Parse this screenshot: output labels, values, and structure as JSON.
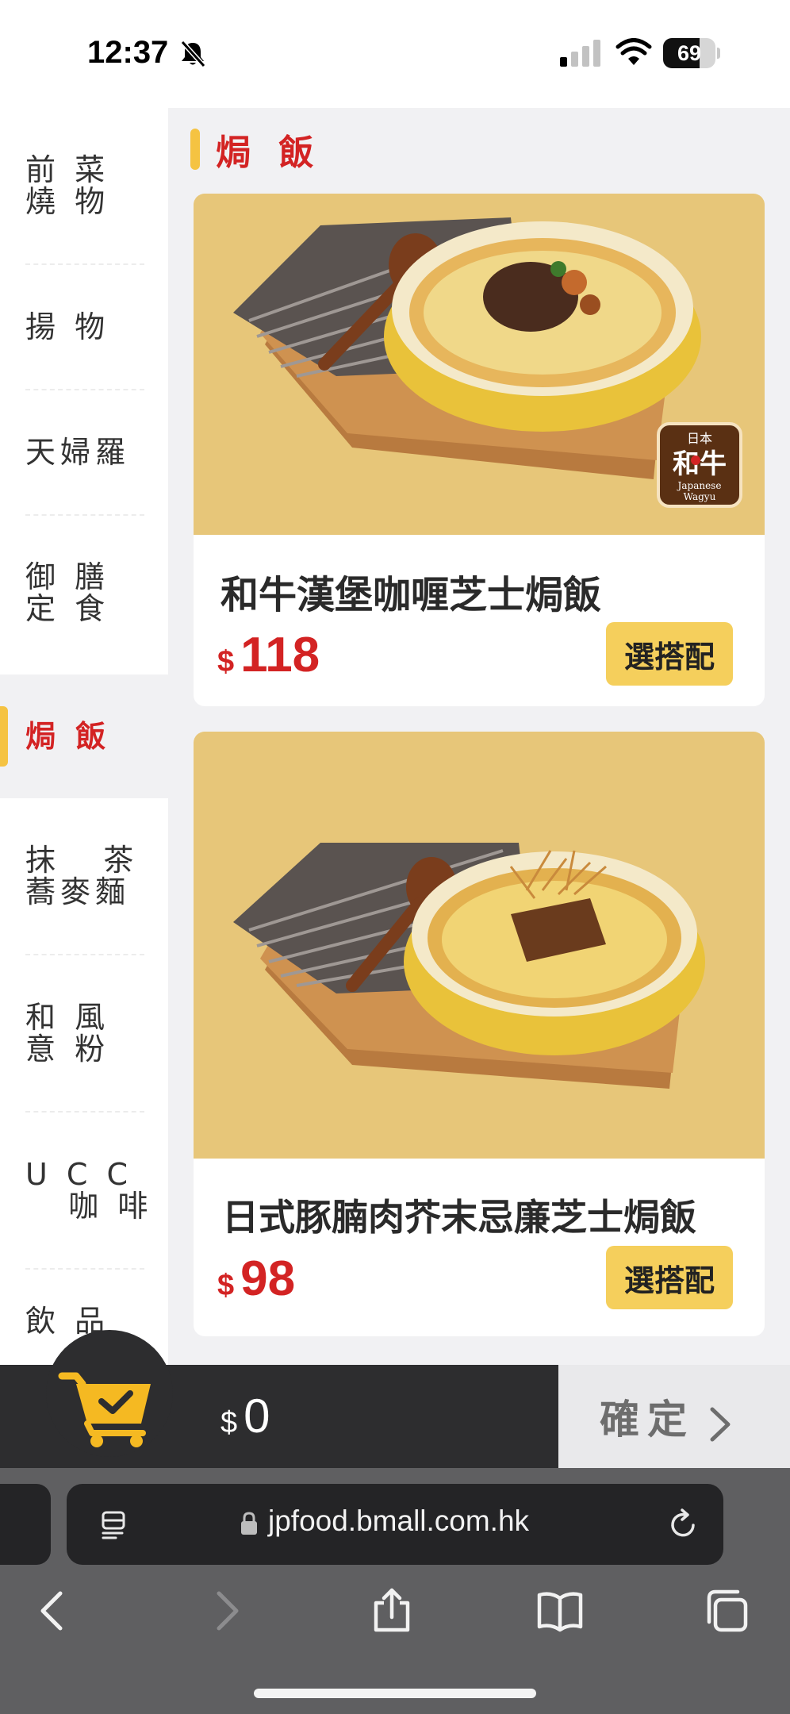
{
  "status_bar": {
    "time": "12:37",
    "battery": "69"
  },
  "sidebar": {
    "items": [
      {
        "label": "前 菜\n燒 物",
        "active": false
      },
      {
        "label": "揚 物",
        "active": false
      },
      {
        "label": "天婦羅",
        "active": false
      },
      {
        "label": "御 膳\n定 食",
        "active": false
      },
      {
        "label": "焗 飯",
        "active": true
      },
      {
        "label": "抹   茶\n蕎麥麵",
        "active": false
      },
      {
        "label": "和 風\n意 粉",
        "active": false
      },
      {
        "label": "U C C\n   咖 啡",
        "active": false
      },
      {
        "label": "飲 品",
        "active": false
      }
    ]
  },
  "section": {
    "title": "焗 飯"
  },
  "products": [
    {
      "name": "和牛漢堡咖喱芝士焗飯",
      "currency": "$",
      "price": "118",
      "button": "選搭配",
      "badge_top": "日本",
      "badge_main": "和牛",
      "badge_sub1": "Japanese",
      "badge_sub2": "Wagyu"
    },
    {
      "name": "日式豚腩肉芥末忌廉芝士焗飯",
      "currency": "$",
      "price": "98",
      "button": "選搭配"
    }
  ],
  "cart": {
    "currency": "$",
    "total": "0",
    "confirm_label": "確定"
  },
  "browser": {
    "url": "jpfood.bmall.com.hk"
  }
}
